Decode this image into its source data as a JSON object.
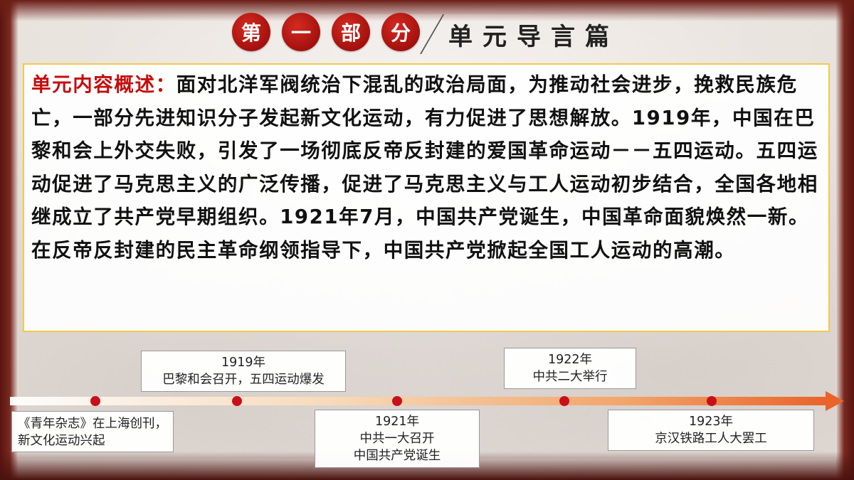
{
  "header": {
    "part_chars": [
      "第",
      "一",
      "部",
      "分"
    ],
    "section_title": "单元导言篇"
  },
  "overview": {
    "label": "单元内容概述：",
    "text": "面对北洋军阀统治下混乱的政治局面，为推动社会进步，挽救民族危亡，一部分先进知识分子发起新文化运动，有力促进了思想解放。1919年，中国在巴黎和会上外交失败，引发了一场彻底反帝反封建的爱国革命运动－－五四运动。五四运动促进了马克思主义的广泛传播，促进了马克思主义与工人运动初步结合，全国各地相继成立了共产党早期组织。1921年7月，中国共产党诞生，中国革命面貌焕然一新。在反帝反封建的民主革命纲领指导下，中国共产党掀起全国工人运动的高潮。"
  },
  "timeline": {
    "events": [
      {
        "year": "",
        "desc": "《青年杂志》在上海创刊，新文化运动兴起"
      },
      {
        "year": "1919年",
        "desc": "巴黎和会召开，五四运动爆发"
      },
      {
        "year": "1921年",
        "desc": "中共一大召开",
        "desc2": "中国共产党诞生"
      },
      {
        "year": "1922年",
        "desc": "中共二大举行"
      },
      {
        "year": "1923年",
        "desc": "京汉铁路工人大罢工"
      }
    ]
  },
  "colors": {
    "accent_red": "#c40e0e",
    "circle_red": "#b8140f",
    "box_border": "#f2c94c",
    "arrow_orange": "#e9632a"
  }
}
